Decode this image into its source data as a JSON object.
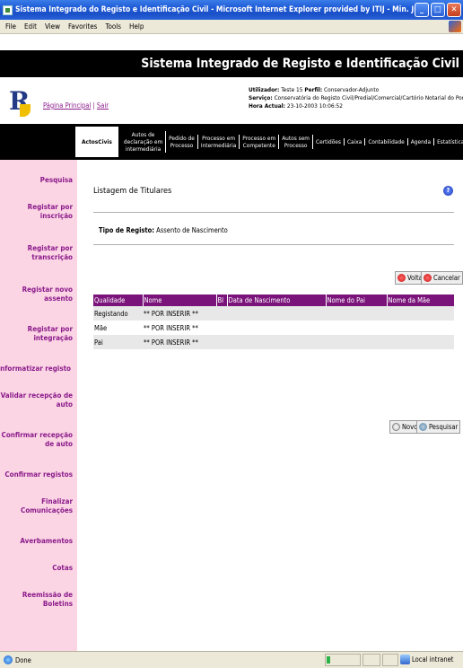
{
  "window": {
    "title": "Sistema Integrado do Registo e Identificação Civil - Microsoft Internet Explorer provided by ITIJ - Min. Justiça"
  },
  "menu": [
    "File",
    "Edit",
    "View",
    "Favorites",
    "Tools",
    "Help"
  ],
  "header": {
    "system_title": "Sistema Integrado de Registo e Identificação Civil",
    "links": {
      "home": "Página Principal",
      "separator": "|",
      "logout": "Sair"
    },
    "user": {
      "utilizador_label": "Utilizador:",
      "utilizador": "Teste 15",
      "perfil_label": "Perfil:",
      "perfil": "Conservador-Adjunto",
      "servico_label": "Serviço:",
      "servico": "Conservatória do Registo Civil/Predial/Comercial/Cartório Notarial do Porto",
      "hora_label": "Hora Actual:",
      "hora": "23-10-2003 10:06:52"
    }
  },
  "nav": {
    "tabs": [
      {
        "label": "ActosCivis",
        "active": true
      },
      {
        "label": "Autos de\ndeclaração em\nintermediária"
      },
      {
        "label": "Pedido de\nProcesso"
      },
      {
        "label": "Processo em\nIntermediária"
      },
      {
        "label": "Processo em\nCompetente"
      },
      {
        "label": "Autos sem\nProcesso"
      },
      {
        "label": "Certidões"
      },
      {
        "label": "Caixa"
      },
      {
        "label": "Contabilidade"
      },
      {
        "label": "Agenda"
      },
      {
        "label": "Estatísticas"
      }
    ]
  },
  "sidebar": {
    "items": [
      "Pesquisa",
      "Registar por\ninscrição",
      "Registar por\ntranscrição",
      "Registar novo\nassento",
      "Registar por\nintegração",
      "Informatizar registo",
      "Validar recepção de\nauto",
      "Confirmar recepção\nde auto",
      "Confirmar registos",
      "Finalizar\nComunicações",
      "Averbamentos",
      "Cotas",
      "Reemissão de\nBoletins"
    ]
  },
  "main": {
    "title": "Listagem de Titulares",
    "help_symbol": "?",
    "tipo_registo_label": "Tipo de Registo:",
    "tipo_registo_value": "Assento de Nascimento",
    "buttons": {
      "voltar": "Voltar",
      "cancelar": "Cancelar",
      "novo": "Novo",
      "pesquisar": "Pesquisar"
    },
    "table": {
      "columns": [
        "Qualidade",
        "Nome",
        "BI",
        "Data de Nascimento",
        "Nome do Pai",
        "Nome da Mãe"
      ],
      "rows": [
        [
          "Registando",
          "** POR INSERIR **",
          "",
          "",
          "",
          ""
        ],
        [
          "Mãe",
          "** POR INSERIR **",
          "",
          "",
          "",
          ""
        ],
        [
          "Pai",
          "** POR INSERIR **",
          "",
          "",
          "",
          ""
        ]
      ]
    }
  },
  "status": {
    "text": "Done",
    "zone": "Local intranet"
  }
}
